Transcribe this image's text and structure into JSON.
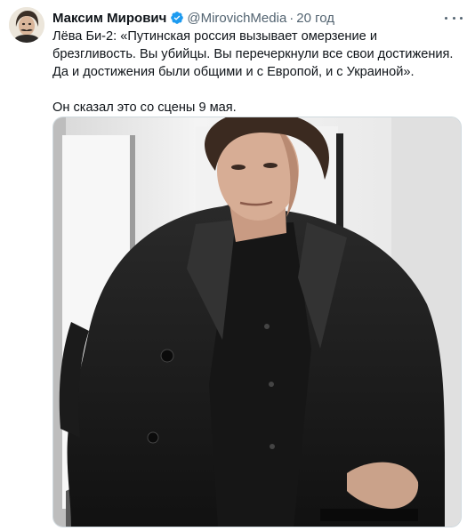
{
  "tweet": {
    "author_name": "Максим Мирович",
    "handle": "@MirovichMedia",
    "separator": "·",
    "time": "20 год",
    "text_paragraphs": [
      "Лёва Би-2: «Путинская россия вызывает омерзение и брезгливость. Вы убийцы. Вы перечеркнули все свои достижения. Да и достижения были общими и с Европой, и с Украиной».",
      "Он сказал это со сцены 9 мая."
    ],
    "icons": {
      "avatar": "avatar-portrait",
      "verified": "verified-badge-icon",
      "more": "more-options-icon"
    },
    "colors": {
      "verified_blue": "#1d9bf0",
      "secondary_text": "#536471",
      "primary_text": "#0f1419",
      "border": "#cfd9de"
    }
  }
}
